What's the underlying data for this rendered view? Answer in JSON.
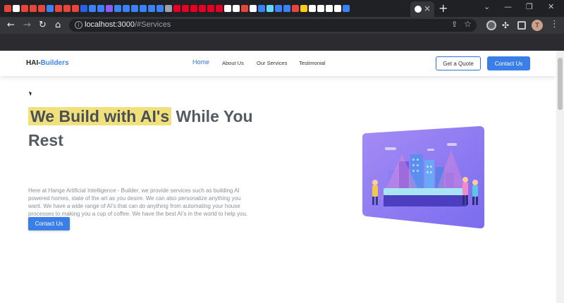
{
  "browser": {
    "url_host": "localhost:3000",
    "url_path": "/#Services",
    "tab_close": "×",
    "new_tab": "+",
    "profile_initial": "T",
    "favicon_colors": [
      "#e8453c",
      "#ffffff",
      "#e8453c",
      "#e8453c",
      "#e8453c",
      "#3b82f6",
      "#e8453c",
      "#e8453c",
      "#e8453c",
      "#2563eb",
      "#3b82f6",
      "#3b82f6",
      "#8b5cf6",
      "#3b82f6",
      "#3b82f6",
      "#3b82f6",
      "#3b82f6",
      "#3b82f6",
      "#3b82f6",
      "#9ca3af",
      "#e60023",
      "#e60023",
      "#e60023",
      "#e60023",
      "#e60023",
      "#e60023",
      "#ffffff",
      "#ffffff",
      "#e8453c",
      "#ffffff",
      "#3b82f6",
      "#61dafb",
      "#3b82f6",
      "#3b82f6",
      "#e8453c",
      "#facc15",
      "#ffffff",
      "#ffffff",
      "#ffffff",
      "#ffffff",
      "#3b82f6"
    ]
  },
  "site": {
    "logo_prefix": "HAI-",
    "logo_suffix": "Builders",
    "nav": {
      "home": "Home",
      "about": "About Us",
      "services": "Our Services",
      "testimonial": "Testimonial"
    },
    "quote_button": "Get a Quote",
    "contact_button": "Contact Us"
  },
  "hero": {
    "title_highlight": "We Build with AI's",
    "title_rest": " While You Rest",
    "description": "Here at Hange Artificial Intelligence - Builder, we provide services such as building AI powered homes, state of the art as you desire. We can also personalize anything you want. We have a wide range of AI's that can do anything from automating your house processes to making you a cup of coffee. We have the best AI's in the world to help you.",
    "cta_button": "Contact Us"
  },
  "colors": {
    "accent": "#3a7ee8",
    "highlight": "#f2e17a",
    "illustration": "#8b7cf6"
  }
}
